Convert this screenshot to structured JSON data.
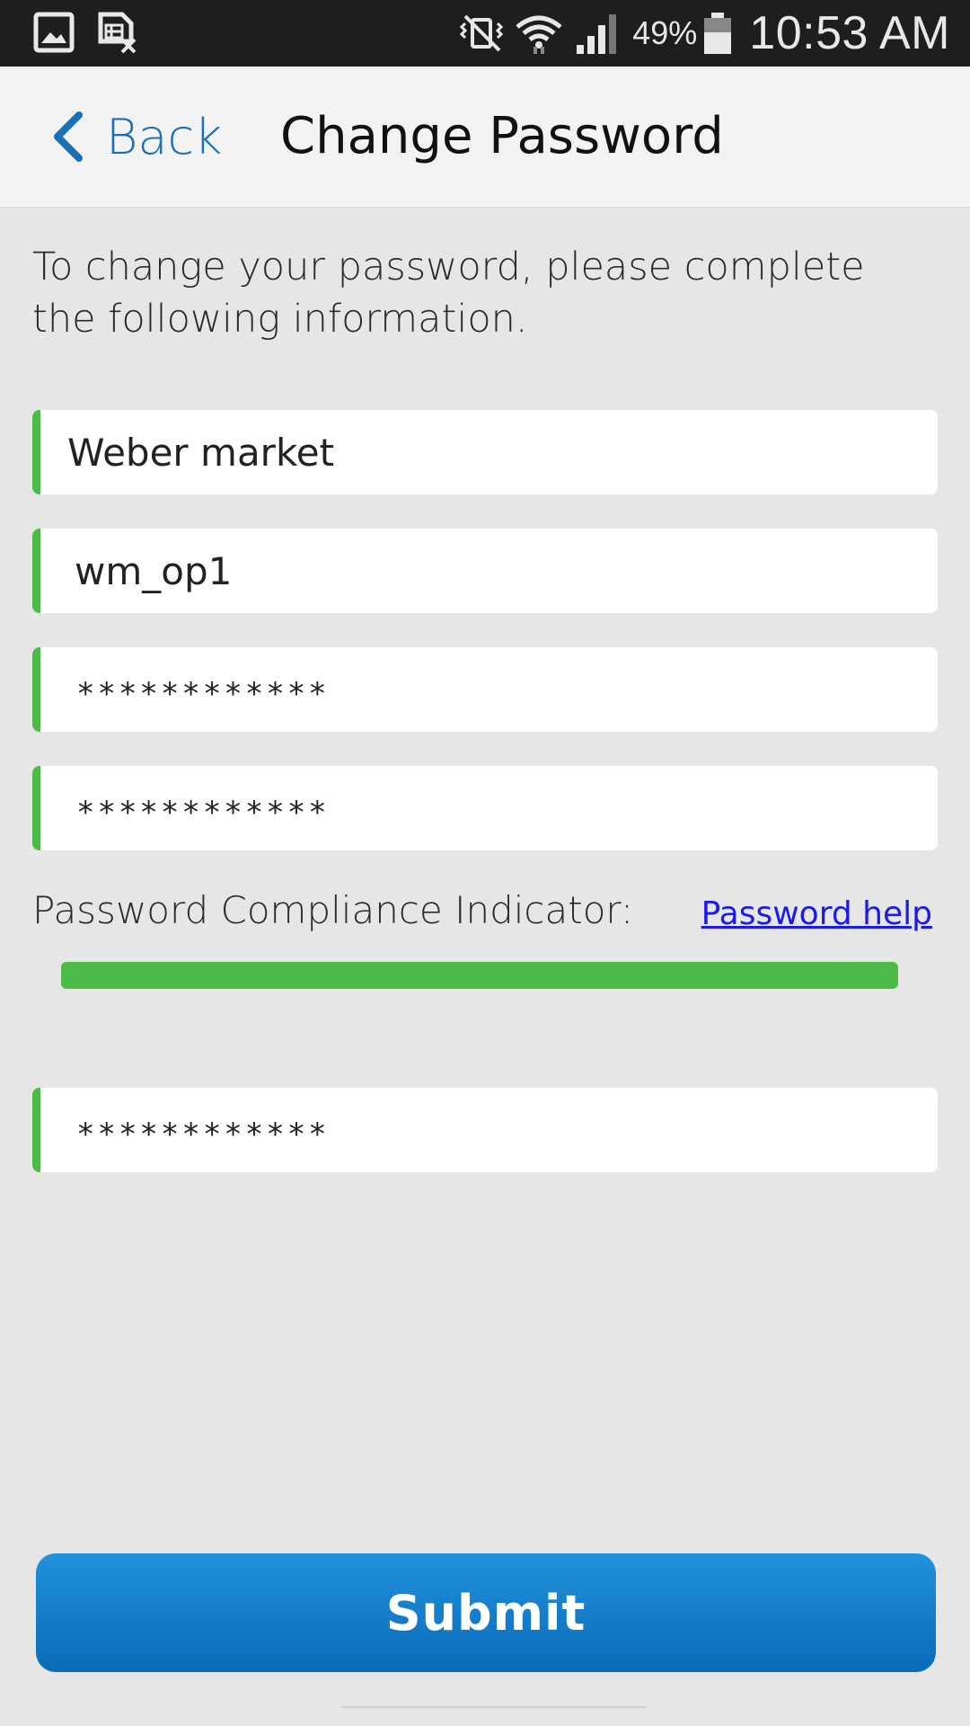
{
  "status_bar": {
    "battery_percent": "49%",
    "time": "10:53 AM",
    "icons": [
      "gallery-icon",
      "sim-error-icon",
      "vibrate-mute-icon",
      "wifi-icon",
      "signal-icon",
      "battery-icon"
    ]
  },
  "header": {
    "back_label": "Back",
    "title": "Change Password"
  },
  "intro_text": "To change your password, please complete the following information.",
  "fields": {
    "market": "Weber market",
    "username": "wm_op1",
    "current_password": "************",
    "new_password": "************",
    "confirm_password": "************"
  },
  "compliance": {
    "label": "Password Compliance Indicator:",
    "help_link": "Password help",
    "level_percent": 100,
    "color": "#4cbb47"
  },
  "submit_label": "Submit",
  "colors": {
    "accent_blue": "#1a6fb5",
    "field_accent_green": "#4cbb47",
    "status_bar": "#1e1e1e",
    "header_bg": "#f3f3f3",
    "page_bg": "#e6e6e6"
  }
}
